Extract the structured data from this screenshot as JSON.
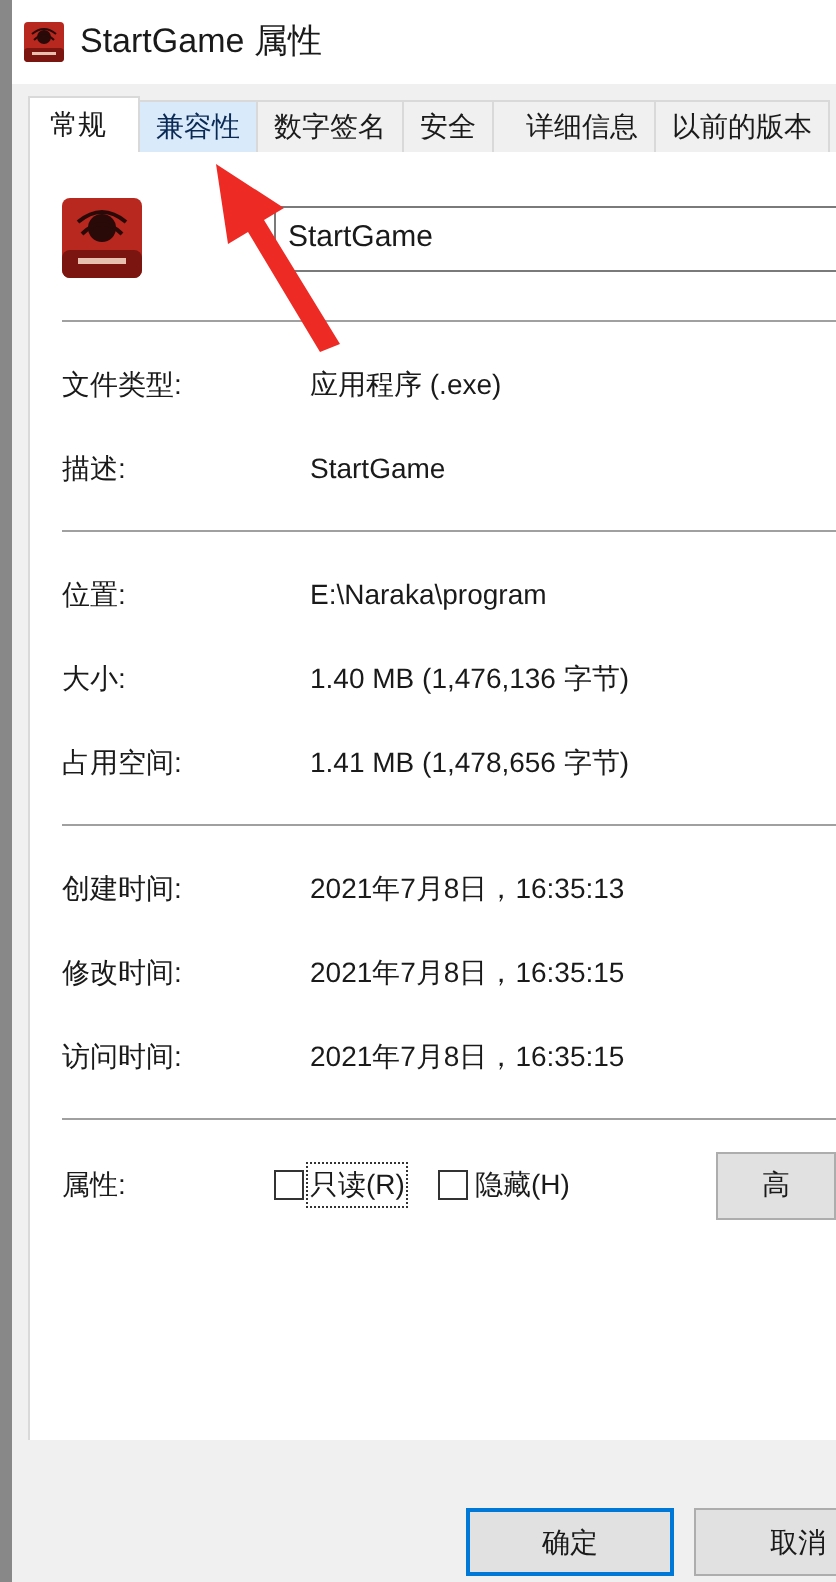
{
  "window": {
    "title": "StartGame 属性"
  },
  "tabs": [
    {
      "label": "常规",
      "selected": true,
      "hovered": false
    },
    {
      "label": "兼容性",
      "selected": false,
      "hovered": true
    },
    {
      "label": "数字签名",
      "selected": false,
      "hovered": false
    },
    {
      "label": "安全",
      "selected": false,
      "hovered": false
    },
    {
      "label": "详细信息",
      "selected": false,
      "hovered": false
    },
    {
      "label": "以前的版本",
      "selected": false,
      "hovered": false
    }
  ],
  "name_field": {
    "value": "StartGame"
  },
  "sections": [
    [
      {
        "label": "文件类型:",
        "value": "应用程序 (.exe)"
      },
      {
        "label": "描述:",
        "value": "StartGame"
      }
    ],
    [
      {
        "label": "位置:",
        "value": "E:\\Naraka\\program"
      },
      {
        "label": "大小:",
        "value": "1.40 MB (1,476,136 字节)"
      },
      {
        "label": "占用空间:",
        "value": "1.41 MB (1,478,656 字节)"
      }
    ],
    [
      {
        "label": "创建时间:",
        "value": "2021年7月8日，16:35:13"
      },
      {
        "label": "修改时间:",
        "value": "2021年7月8日，16:35:15"
      },
      {
        "label": "访问时间:",
        "value": "2021年7月8日，16:35:15"
      }
    ]
  ],
  "attributes": {
    "label": "属性:",
    "options": [
      {
        "label": "只读(R)",
        "checked": false,
        "focused": true
      },
      {
        "label": "隐藏(H)",
        "checked": false,
        "focused": false
      }
    ],
    "advanced_button": "高"
  },
  "buttons": [
    {
      "label": "确定",
      "default": true
    },
    {
      "label": "取消",
      "default": false
    }
  ]
}
